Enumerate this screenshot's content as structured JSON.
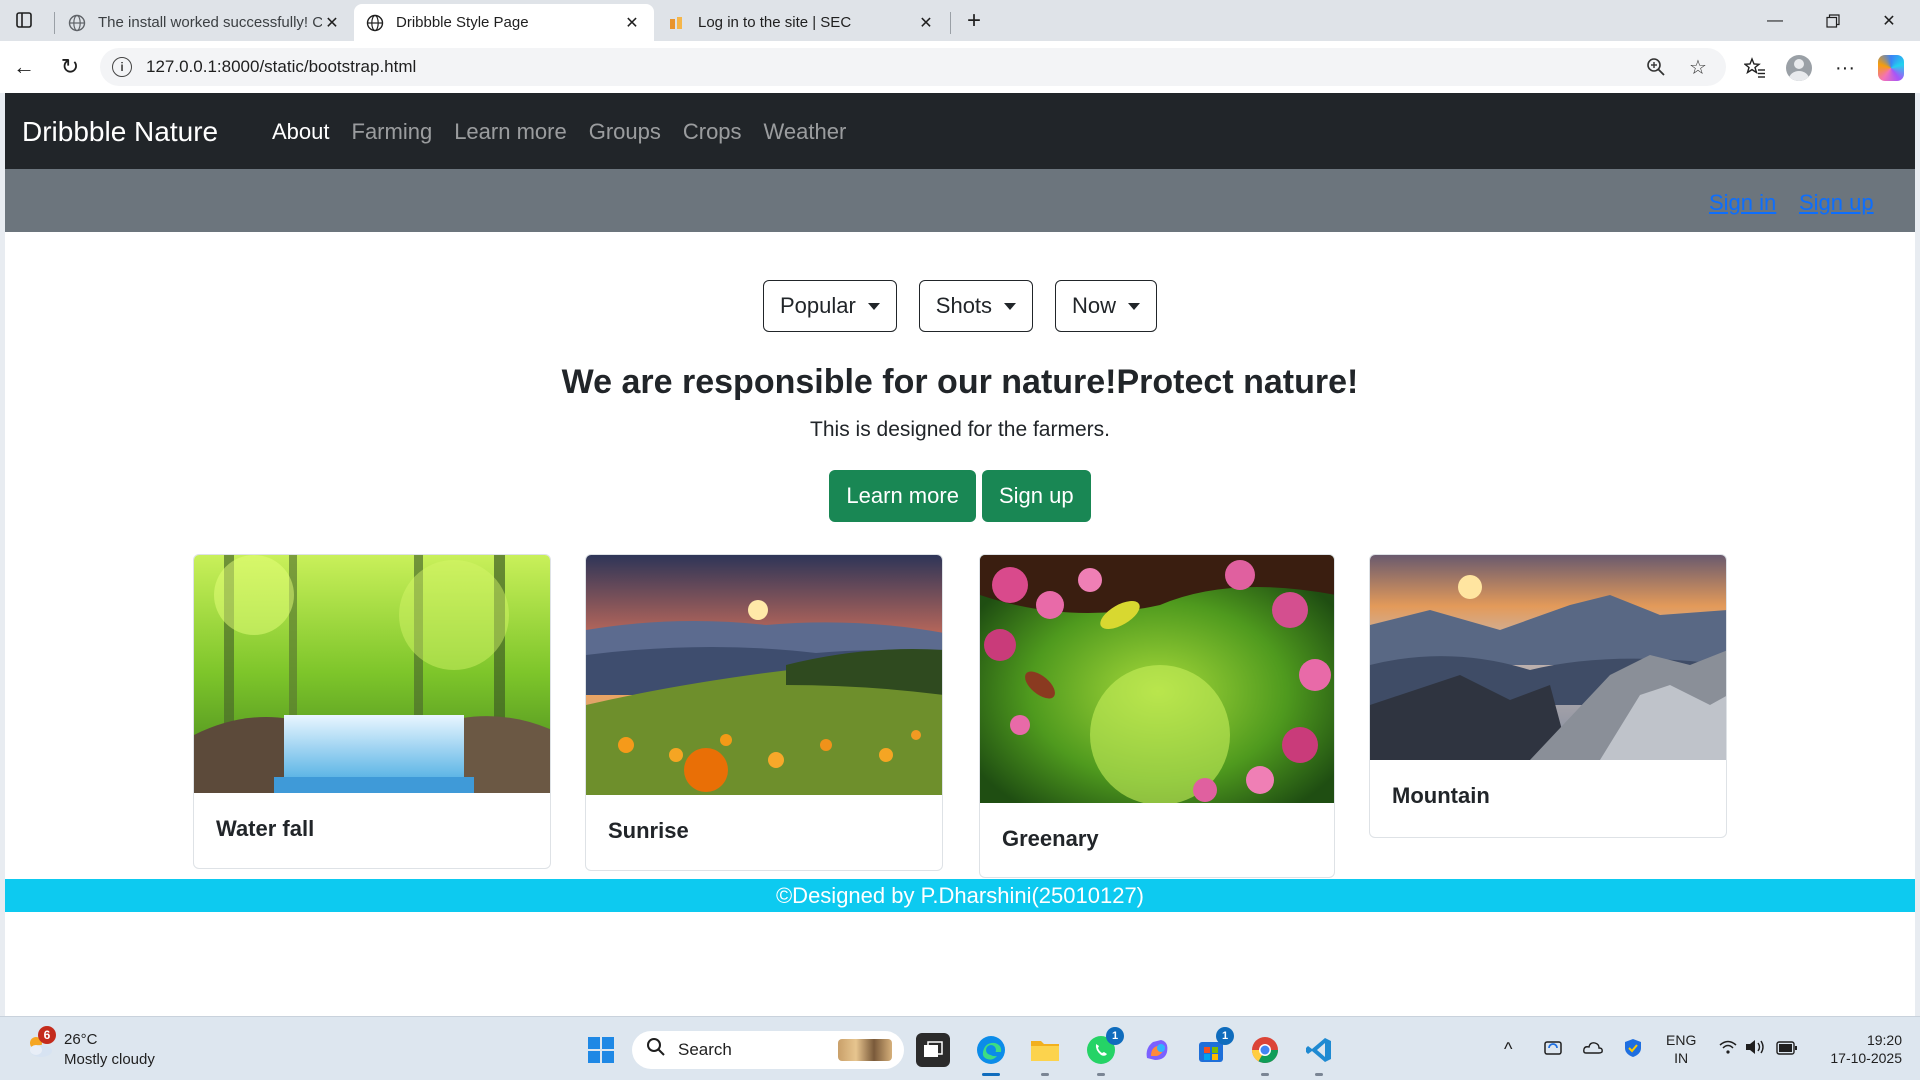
{
  "browser": {
    "tabs": [
      {
        "title": "The install worked successfully! Co",
        "active": false
      },
      {
        "title": "Dribbble Style Page",
        "active": true
      },
      {
        "title": "Log in to the site | SEC",
        "active": false
      }
    ],
    "url": "127.0.0.1:8000/static/bootstrap.html"
  },
  "page": {
    "brand": "Dribbble Nature",
    "nav": [
      "About",
      "Farming",
      "Learn more",
      "Groups",
      "Crops",
      "Weather"
    ],
    "auth": {
      "sign_in": "Sign in",
      "sign_up": "Sign up"
    },
    "filters": [
      "Popular",
      "Shots",
      "Now"
    ],
    "headline": "We are responsible for our nature!Protect nature!",
    "subtext": "This is designed for the farmers.",
    "cta": {
      "learn_more": "Learn more",
      "sign_up": "Sign up"
    },
    "cards": [
      {
        "title": "Water fall"
      },
      {
        "title": "Sunrise"
      },
      {
        "title": "Greenary"
      },
      {
        "title": "Mountain"
      }
    ],
    "footer": "©Designed by P.Dharshini(25010127)"
  },
  "taskbar": {
    "weather": {
      "temp": "26°C",
      "desc": "Mostly cloudy",
      "badge": "6"
    },
    "search_label": "Search",
    "badges": {
      "whatsapp": "1",
      "store": "1"
    },
    "lang": {
      "line1": "ENG",
      "line2": "IN"
    },
    "clock": {
      "time": "19:20",
      "date": "17-10-2025"
    }
  },
  "colors": {
    "navbar": "#212529",
    "subbar": "#6c757d",
    "success": "#198754",
    "footer": "#0dcaf0",
    "link": "#0d6efd"
  }
}
